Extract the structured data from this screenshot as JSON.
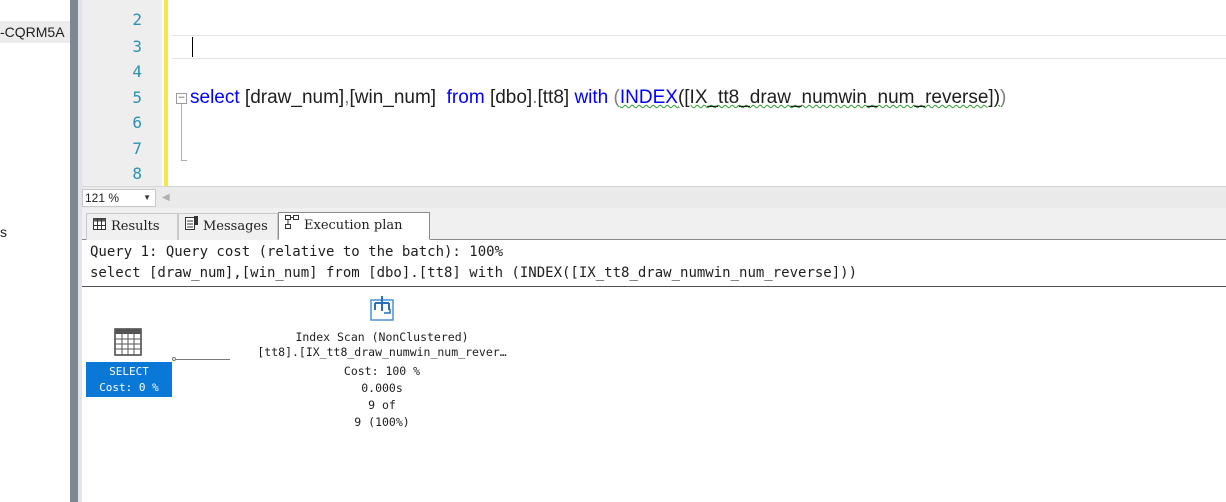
{
  "explorer": {
    "server_fragment": "-CQRM5A",
    "tree_fragment": "s"
  },
  "editor": {
    "line_numbers": [
      "2",
      "3",
      "4",
      "5",
      "6",
      "7",
      "8"
    ],
    "code": {
      "select": "select",
      "cols": "[draw_num]",
      "comma": ",",
      "col2": "[win_num]",
      "from": "from",
      "table": "[dbo]",
      "dot": ".",
      "table2": "[tt8]",
      "with": "with",
      "open": "(",
      "index": "INDEX",
      "index_arg": "([IX_tt8_draw_numwin_num_reverse])",
      "close": ")"
    }
  },
  "zoom": {
    "value": "121 %"
  },
  "tabs": [
    {
      "label": "Results"
    },
    {
      "label": "Messages"
    },
    {
      "label": "Execution plan"
    }
  ],
  "plan": {
    "query_header": "Query 1: Query cost (relative to the batch): 100%",
    "query_text": "select [draw_num],[win_num] from [dbo].[tt8] with (INDEX([IX_tt8_draw_numwin_num_reverse]))",
    "select_node": {
      "label": "SELECT",
      "cost": "Cost: 0 %"
    },
    "scan_node": {
      "title": "Index Scan (NonClustered)",
      "object": "[tt8].[IX_tt8_draw_numwin_num_rever…",
      "cost": "Cost: 100 %",
      "time": "0.000s",
      "rows_of": "9 of",
      "rows_est": "9 (100%)"
    }
  },
  "colors": {
    "keyword": "#0000ff",
    "selected_node": "#0a78d7",
    "line_number": "#2b91af",
    "change_bar": "#f3e84a"
  }
}
